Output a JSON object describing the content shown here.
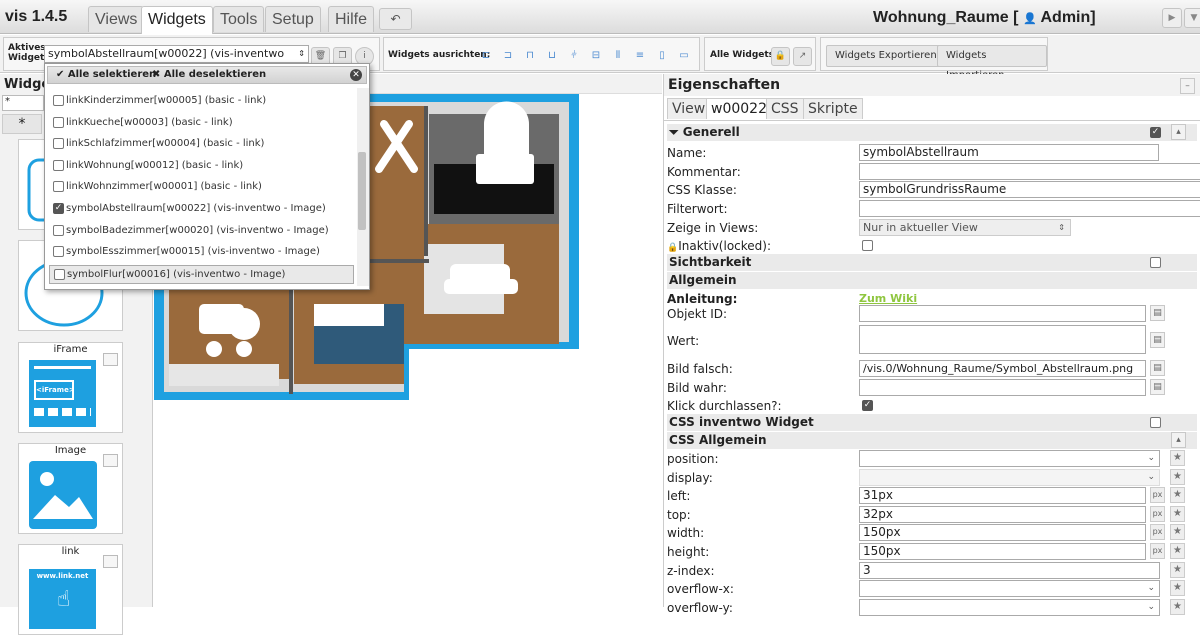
{
  "app": {
    "version": "vis 1.4.5",
    "project_title": "Wohnung_Raume [",
    "user": "Admin]"
  },
  "menu_tabs": [
    {
      "label": "Views"
    },
    {
      "label": "Widgets"
    },
    {
      "label": "Tools"
    },
    {
      "label": "Setup"
    },
    {
      "label": "Hilfe"
    }
  ],
  "toolbar": {
    "active_widget_label_1": "Aktives",
    "active_widget_label_2": "Widget:",
    "active_widget_value": "symbolAbstellraum[w00022] (vis-inventwo",
    "align_label": "Widgets ausrichten:",
    "all_widgets_label": "Alle Widgets:",
    "export_label": "Widgets Exportieren",
    "import_label": "Widgets Importieren"
  },
  "dropdown": {
    "select_all": "Alle selektieren",
    "deselect_all": "Alle deselektieren",
    "options": [
      {
        "label": "linkKinderzimmer[w00005] (basic - link)",
        "checked": false
      },
      {
        "label": "linkKueche[w00003] (basic - link)",
        "checked": false
      },
      {
        "label": "linkSchlafzimmer[w00004] (basic - link)",
        "checked": false
      },
      {
        "label": "linkWohnung[w00012] (basic - link)",
        "checked": false
      },
      {
        "label": "linkWohnzimmer[w00001] (basic - link)",
        "checked": false
      },
      {
        "label": "symbolAbstellraum[w00022] (vis-inventwo - Image)",
        "checked": true
      },
      {
        "label": "symbolBadezimmer[w00020] (vis-inventwo - Image)",
        "checked": false
      },
      {
        "label": "symbolEsszimmer[w00015] (vis-inventwo - Image)",
        "checked": false
      },
      {
        "label": "symbolFlur[w00016] (vis-inventwo - Image)",
        "checked": false
      }
    ]
  },
  "left_panel": {
    "title": "Widge",
    "filter": "*",
    "star": "*",
    "cards": [
      {
        "label": ""
      },
      {
        "label": ""
      },
      {
        "label": "iFrame"
      },
      {
        "label": "Image"
      },
      {
        "label": "link"
      }
    ],
    "iframe_text": "<iFrame>",
    "link_text": "www.link.net"
  },
  "properties": {
    "title": "Eigenschaften",
    "tabs": [
      {
        "label": "View"
      },
      {
        "label": "w00022"
      },
      {
        "label": "CSS"
      },
      {
        "label": "Skripte"
      }
    ],
    "sections": {
      "generell": "Generell",
      "sichtbarkeit": "Sichtbarkeit",
      "allgemein": "Allgemein",
      "css_inventwo": "CSS inventwo Widget",
      "css_allgemein": "CSS Allgemein"
    },
    "fields": {
      "name_label": "Name:",
      "name_value": "symbolAbstellraum",
      "kommentar_label": "Kommentar:",
      "css_klasse_label": "CSS Klasse:",
      "css_klasse_value": "symbolGrundrissRaume",
      "filterwort_label": "Filterwort:",
      "zeige_label": "Zeige in Views:",
      "zeige_value": "Nur in aktueller View",
      "inaktiv_label": "Inaktiv(locked):",
      "anleitung_label": "Anleitung:",
      "anleitung_link": "Zum Wiki",
      "objekt_label": "Objekt ID:",
      "wert_label": "Wert:",
      "bild_falsch_label": "Bild falsch:",
      "bild_falsch_value": "/vis.0/Wohnung_Raume/Symbol_Abstellraum.png",
      "bild_wahr_label": "Bild wahr:",
      "klick_label": "Klick durchlassen?:"
    },
    "css": [
      {
        "label": "position:",
        "value": "",
        "kind": "select"
      },
      {
        "label": "display:",
        "value": "",
        "kind": "select"
      },
      {
        "label": "left:",
        "value": "31px",
        "kind": "px"
      },
      {
        "label": "top:",
        "value": "32px",
        "kind": "px"
      },
      {
        "label": "width:",
        "value": "150px",
        "kind": "px"
      },
      {
        "label": "height:",
        "value": "150px",
        "kind": "px"
      },
      {
        "label": "z-index:",
        "value": "3",
        "kind": "num"
      },
      {
        "label": "overflow-x:",
        "value": "",
        "kind": "select"
      },
      {
        "label": "overflow-y:",
        "value": "",
        "kind": "select"
      }
    ],
    "px_unit": "px"
  },
  "colors": {
    "accent_blue": "#1ea0e0",
    "wiki_green": "#8fc63f",
    "floor_wood": "#9a6a3c"
  }
}
